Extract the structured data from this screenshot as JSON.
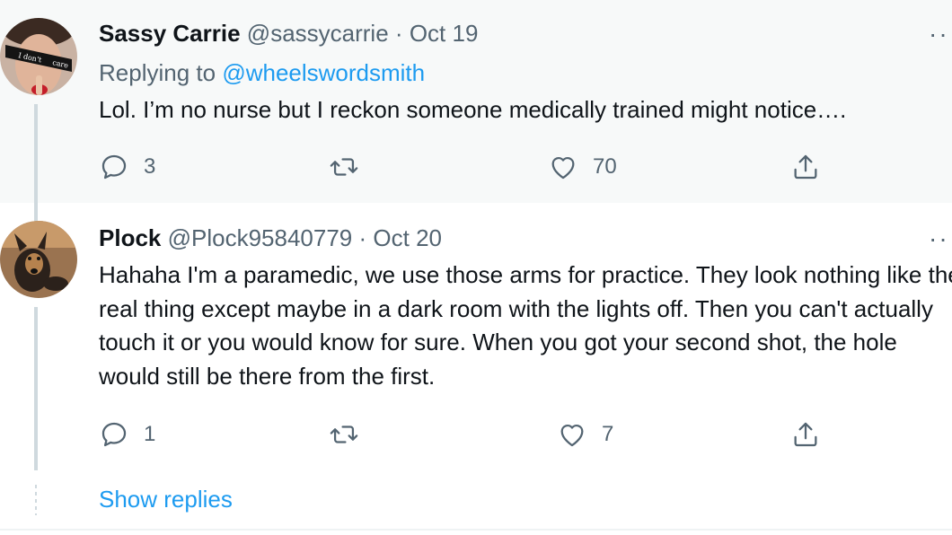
{
  "tweets": [
    {
      "display_name": "Sassy Carrie",
      "handle": "@sassycarrie",
      "date_sep": "·",
      "date": "Oct 19",
      "replying_prefix": "Replying to",
      "replying_handle": "@wheelswordsmith",
      "text": "Lol. I’m no nurse but I reckon someone medically trained might notice….",
      "reply_count": "3",
      "retweet_count": "",
      "like_count": "70",
      "more": "··",
      "avatar_icon": "avatar-woman-sunglasses",
      "sunglasses_text_left": "I don't",
      "sunglasses_text_right": "care"
    },
    {
      "display_name": "Plock",
      "handle": "@Plock95840779",
      "date_sep": "·",
      "date": "Oct 20",
      "text": "Hahaha I'm a paramedic, we use those arms for practice. They look nothing like the real thing except maybe in a dark room with the lights off. Then you can't actually touch it or you would know for sure. When you got your second shot, the hole would still be there from the first.",
      "reply_count": "1",
      "retweet_count": "",
      "like_count": "7",
      "more": "··",
      "avatar_icon": "avatar-dog"
    }
  ],
  "show_replies": "Show replies",
  "colors": {
    "link": "#1d9bf0",
    "muted": "#536471",
    "highlight_bg": "#f7f9f9"
  }
}
